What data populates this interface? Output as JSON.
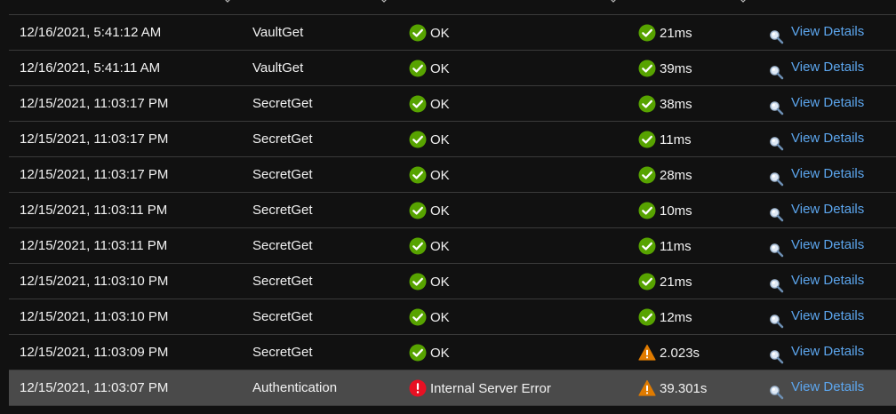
{
  "colors": {
    "ok_green": "#57a300",
    "warning_orange": "#e07b00",
    "error_red": "#e81123",
    "link_blue": "#5ca6ee"
  },
  "rows": [
    {
      "time": "12/16/2021, 5:41:12 AM",
      "operation": "VaultGet",
      "result": "OK",
      "result_icon": "check-circle-icon",
      "duration": "21ms",
      "duration_icon": "check-circle-icon",
      "details_label": "View Details",
      "selected": false
    },
    {
      "time": "12/16/2021, 5:41:11 AM",
      "operation": "VaultGet",
      "result": "OK",
      "result_icon": "check-circle-icon",
      "duration": "39ms",
      "duration_icon": "check-circle-icon",
      "details_label": "View Details",
      "selected": false
    },
    {
      "time": "12/15/2021, 11:03:17 PM",
      "operation": "SecretGet",
      "result": "OK",
      "result_icon": "check-circle-icon",
      "duration": "38ms",
      "duration_icon": "check-circle-icon",
      "details_label": "View Details",
      "selected": false
    },
    {
      "time": "12/15/2021, 11:03:17 PM",
      "operation": "SecretGet",
      "result": "OK",
      "result_icon": "check-circle-icon",
      "duration": "11ms",
      "duration_icon": "check-circle-icon",
      "details_label": "View Details",
      "selected": false
    },
    {
      "time": "12/15/2021, 11:03:17 PM",
      "operation": "SecretGet",
      "result": "OK",
      "result_icon": "check-circle-icon",
      "duration": "28ms",
      "duration_icon": "check-circle-icon",
      "details_label": "View Details",
      "selected": false
    },
    {
      "time": "12/15/2021, 11:03:11 PM",
      "operation": "SecretGet",
      "result": "OK",
      "result_icon": "check-circle-icon",
      "duration": "10ms",
      "duration_icon": "check-circle-icon",
      "details_label": "View Details",
      "selected": false
    },
    {
      "time": "12/15/2021, 11:03:11 PM",
      "operation": "SecretGet",
      "result": "OK",
      "result_icon": "check-circle-icon",
      "duration": "11ms",
      "duration_icon": "check-circle-icon",
      "details_label": "View Details",
      "selected": false
    },
    {
      "time": "12/15/2021, 11:03:10 PM",
      "operation": "SecretGet",
      "result": "OK",
      "result_icon": "check-circle-icon",
      "duration": "21ms",
      "duration_icon": "check-circle-icon",
      "details_label": "View Details",
      "selected": false
    },
    {
      "time": "12/15/2021, 11:03:10 PM",
      "operation": "SecretGet",
      "result": "OK",
      "result_icon": "check-circle-icon",
      "duration": "12ms",
      "duration_icon": "check-circle-icon",
      "details_label": "View Details",
      "selected": false
    },
    {
      "time": "12/15/2021, 11:03:09 PM",
      "operation": "SecretGet",
      "result": "OK",
      "result_icon": "check-circle-icon",
      "duration": "2.023s",
      "duration_icon": "warning-triangle-icon",
      "details_label": "View Details",
      "selected": false
    },
    {
      "time": "12/15/2021, 11:03:07 PM",
      "operation": "Authentication",
      "result": "Internal Server Error",
      "result_icon": "error-circle-icon",
      "duration": "39.301s",
      "duration_icon": "warning-triangle-icon",
      "details_label": "View Details",
      "selected": true
    }
  ]
}
